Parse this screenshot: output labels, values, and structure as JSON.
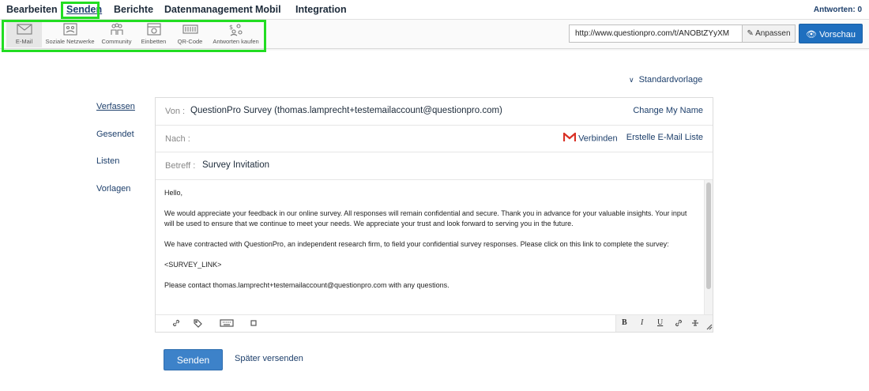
{
  "topnav": {
    "items": [
      "Bearbeiten",
      "Senden",
      "Berichte",
      "Datenmanagement",
      "Mobil",
      "Integration"
    ],
    "active": "Senden",
    "responses": "Antworten: 0"
  },
  "channels": [
    {
      "label": "E-Mail",
      "icon": "envelope-icon",
      "active": true
    },
    {
      "label": "Soziale Netzwerke",
      "icon": "social-network-icon",
      "active": false
    },
    {
      "label": "Community",
      "icon": "community-icon",
      "active": false
    },
    {
      "label": "Einbetten",
      "icon": "embed-icon",
      "active": false
    },
    {
      "label": "QR-Code",
      "icon": "qr-code-icon",
      "active": false
    },
    {
      "label": "Antworten kaufen",
      "icon": "buy-responses-icon",
      "active": false
    }
  ],
  "share": {
    "url": "http://www.questionpro.com/t/ANOBtZYyXM",
    "customize_label": "Anpassen",
    "preview_label": "Vorschau"
  },
  "template": {
    "selected": "Standardvorlage"
  },
  "leftmenu": {
    "items": [
      "Verfassen",
      "Gesendet",
      "Listen",
      "Vorlagen"
    ],
    "active": "Verfassen"
  },
  "compose": {
    "from_label": "Von :",
    "from_value": "QuestionPro Survey (thomas.lamprecht+testemailaccount@questionpro.com)",
    "change_name": "Change My Name",
    "to_label": "Nach :",
    "connect_label": "Verbinden",
    "create_list": "Erstelle E-Mail Liste",
    "subject_label": "Betreff :",
    "subject_value": "Survey Invitation",
    "body": [
      "Hello,",
      "We would appreciate your feedback in our online survey.  All responses will remain confidential and secure.  Thank you in advance for your valuable insights.  Your input will be used to ensure that we continue to meet your needs. We appreciate your trust and look forward to serving you in the future.",
      "We have contracted with QuestionPro, an independent research firm, to field your confidential survey responses.  Please click on this link to complete the survey:",
      "<SURVEY_LINK>",
      "Please contact thomas.lamprecht+testemailaccount@questionpro.com with any questions."
    ],
    "format_buttons": [
      "B",
      "I",
      "U"
    ]
  },
  "actions": {
    "send_label": "Senden",
    "later_label": "Später versenden"
  },
  "colors": {
    "highlight": "#22dd22",
    "primary": "#1f6fbf",
    "link": "#1d3f6b",
    "gmail_red": "#d93025"
  }
}
